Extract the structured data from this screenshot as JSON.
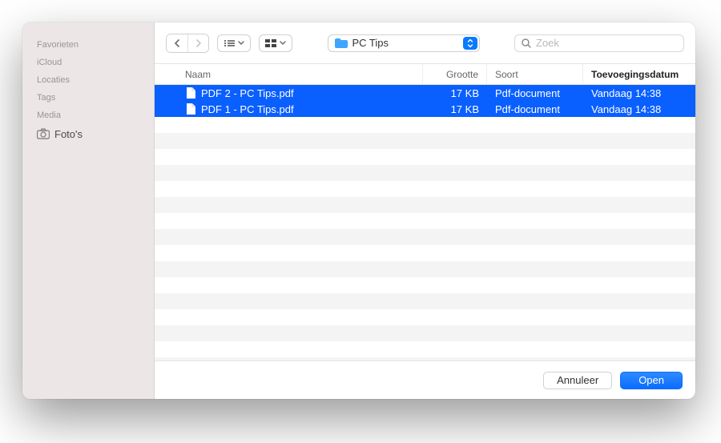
{
  "sidebar": {
    "sections": [
      {
        "label": "Favorieten",
        "items": []
      },
      {
        "label": "iCloud",
        "items": []
      },
      {
        "label": "Locaties",
        "items": []
      },
      {
        "label": "Tags",
        "items": []
      },
      {
        "label": "Media",
        "items": [
          {
            "icon": "camera-icon",
            "label": "Foto's"
          }
        ]
      }
    ]
  },
  "toolbar": {
    "path_label": "PC Tips",
    "search_placeholder": "Zoek"
  },
  "table": {
    "columns": {
      "name": "Naam",
      "size": "Grootte",
      "kind": "Soort",
      "date": "Toevoegingsdatum"
    },
    "rows": [
      {
        "name": "PDF 2 - PC Tips.pdf",
        "size": "17 KB",
        "kind": "Pdf-document",
        "date": "Vandaag 14:38",
        "selected": true
      },
      {
        "name": "PDF 1 - PC Tips.pdf",
        "size": "17 KB",
        "kind": "Pdf-document",
        "date": "Vandaag 14:38",
        "selected": true
      }
    ]
  },
  "footer": {
    "cancel": "Annuleer",
    "open": "Open"
  }
}
